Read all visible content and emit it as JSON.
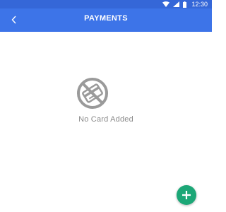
{
  "status_bar": {
    "time": "12:30",
    "icons": [
      "wifi-icon",
      "signal-icon",
      "battery-icon"
    ],
    "background": "#3567d8"
  },
  "app_bar": {
    "back_label": "<",
    "title": "PAYMENTS",
    "background": "#3d74e8"
  },
  "empty_state": {
    "icon": "no-card-icon",
    "message": "No Card Added"
  },
  "fab": {
    "icon": "plus-icon",
    "color": "#1ca777"
  }
}
